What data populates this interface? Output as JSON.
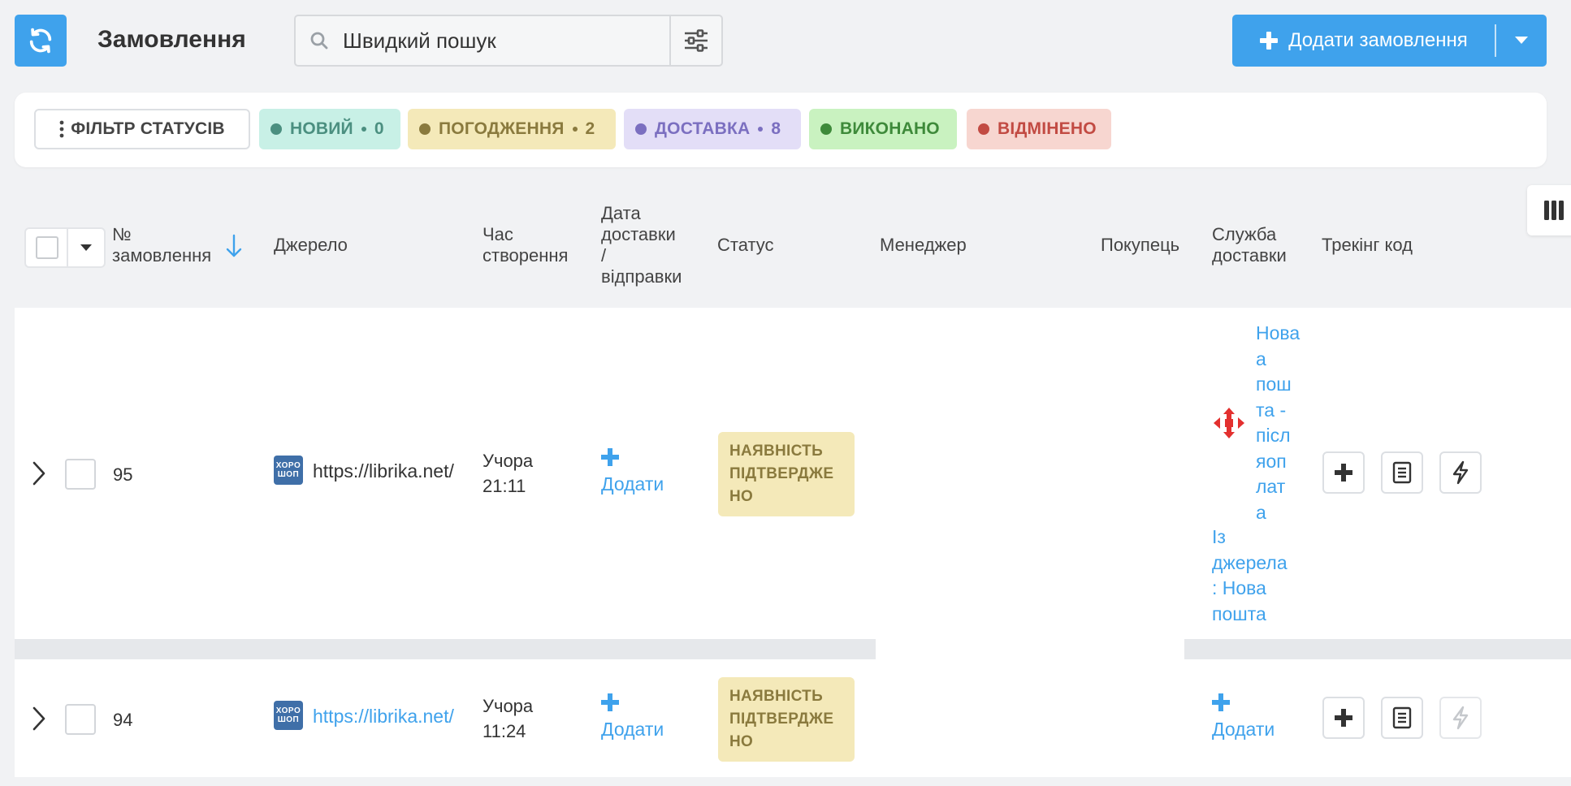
{
  "header": {
    "title": "Замовлення",
    "search_placeholder": "Швидкий пошук",
    "add_order_label": "Додати замовлення"
  },
  "status_filter": {
    "filter_label": "ФІЛЬТР СТАТУСІВ",
    "chips": [
      {
        "label": "НОВИЙ",
        "count": "0",
        "bg": "#c8f0e6",
        "fg": "#4b8f80",
        "dot": "#4b8f80"
      },
      {
        "label": "ПОГОДЖЕННЯ",
        "count": "2",
        "bg": "#f4e9b9",
        "fg": "#8a7a3e",
        "dot": "#8a7a3e"
      },
      {
        "label": "ДОСТАВКА",
        "count": "8",
        "bg": "#e3def7",
        "fg": "#7b6fc0",
        "dot": "#7b6fc0"
      },
      {
        "label": "ВИКОНАНО",
        "bg": "#c9f2c0",
        "fg": "#3e8a3a",
        "dot": "#3e8a3a"
      },
      {
        "label": "ВІДМІНЕНО",
        "bg": "#f7d6d0",
        "fg": "#c24b43",
        "dot": "#c24b43"
      }
    ]
  },
  "table": {
    "columns": {
      "order_no_line1": "№",
      "order_no_line2": "замовлення",
      "source": "Джерело",
      "created_line1": "Час",
      "created_line2": "створення",
      "delivery_date_line1": "Дата",
      "delivery_date_line2": "доставки",
      "delivery_date_line3": "/",
      "delivery_date_line4": "відправки",
      "status": "Статус",
      "manager": "Менеджер",
      "buyer": "Покупець",
      "shipping_line1": "Служба",
      "shipping_line2": "доставки",
      "tracking": "Трекінг код"
    },
    "rows": [
      {
        "order_no": "95",
        "source_logo_line1": "ХОРО",
        "source_logo_line2": "ШОП",
        "source": "https://librika.net/",
        "created_line1": "Учора",
        "created_line2": "21:11",
        "delivery_add_label": "Додати",
        "status_line1": "НАЯВНІСТЬ",
        "status_line2": "ПІДТВЕРДЖЕ",
        "status_line3": "НО",
        "shipping_lines": [
          "Нова",
          "а",
          "пош",
          "та -",
          "піс",
          "яоп",
          "лат",
          "а"
        ],
        "shipping_service_lines_plain": [
          "Нова",
          "пош",
          "та -",
          "післ",
          "яоп",
          "лат",
          "а"
        ],
        "shipping_source_lines": [
          "Із",
          "джерела",
          ": Нова",
          "пошта"
        ]
      },
      {
        "order_no": "94",
        "source_logo_line1": "ХОРО",
        "source_logo_line2": "ШОП",
        "source": "https://librika.net/",
        "created_line1": "Учора",
        "created_line2": "11:24",
        "delivery_add_label": "Додати",
        "status_line1": "НАЯВНІСТЬ",
        "status_line2": "ПІДТВЕРДЖЕ",
        "status_line3": "НО",
        "shipping_add_label": "Додати"
      }
    ]
  },
  "colors": {
    "accent": "#3fa2ec",
    "nova_poshta_red": "#e3302f"
  }
}
